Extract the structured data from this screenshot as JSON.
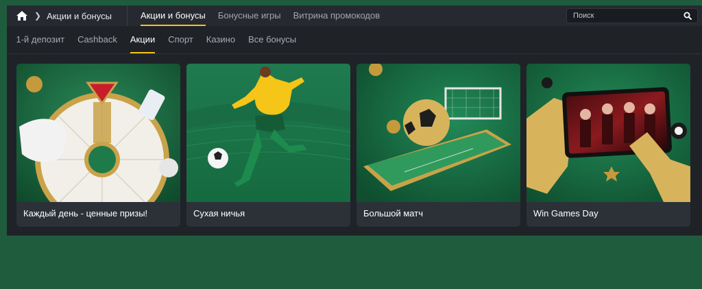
{
  "breadcrumb": {
    "current": "Акции и бонусы"
  },
  "top_tabs": [
    {
      "label": "Акции и бонусы",
      "active": true
    },
    {
      "label": "Бонусные игры",
      "active": false
    },
    {
      "label": "Витрина промокодов",
      "active": false
    }
  ],
  "search": {
    "placeholder": "Поиск",
    "value": ""
  },
  "sub_tabs": [
    {
      "label": "1-й депозит",
      "active": false
    },
    {
      "label": "Cashback",
      "active": false
    },
    {
      "label": "Акции",
      "active": true
    },
    {
      "label": "Спорт",
      "active": false
    },
    {
      "label": "Казино",
      "active": false
    },
    {
      "label": "Все бонусы",
      "active": false
    }
  ],
  "cards": [
    {
      "title": "Каждый день - ценные призы!"
    },
    {
      "title": "Сухая ничья"
    },
    {
      "title": "Большой матч"
    },
    {
      "title": "Win Games Day"
    }
  ],
  "colors": {
    "accent": "#f5c518",
    "panel": "#1f2328",
    "page_background": "#1f5c3e",
    "card_image_green": "#1e6a42"
  },
  "icons": {
    "home": "home-icon",
    "breadcrumb_separator": "chevron-right-icon",
    "search": "search-icon"
  }
}
